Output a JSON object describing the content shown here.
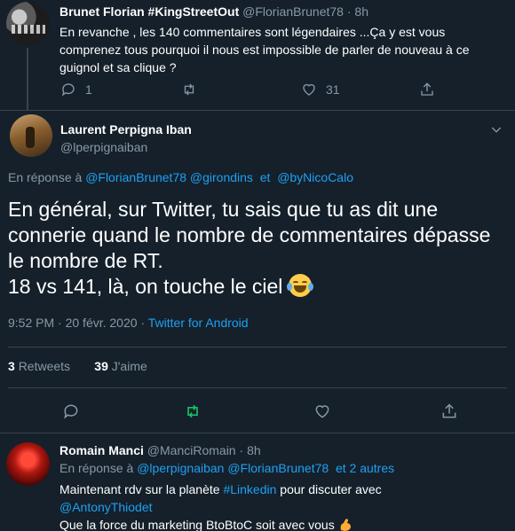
{
  "tweet_parent": {
    "name": "Brunet Florian #KingStreetOut",
    "handle": "@FlorianBrunet78",
    "time": "8h",
    "text": "En revanche , les 140 commentaires sont légendaires ...Ça y est vous comprenez tous pourquoi il nous est impossible de parler de nouveau à ce guignol et sa clique ?",
    "reply_count": "1",
    "like_count": "31"
  },
  "main_tweet": {
    "name": "Laurent Perpigna Iban",
    "handle": "@lperpignaiban",
    "replying_prefix": "En réponse à",
    "replying_to": [
      "@FlorianBrunet78",
      "@girondins",
      "@byNicoCalo"
    ],
    "replying_and": "et",
    "body_lines": [
      "En général, sur Twitter, tu sais que tu as dit une connerie quand le nombre de commentaires dépasse le nombre de RT.",
      "18 vs 141,  là, on touche le ciel"
    ],
    "time": "9:52 PM",
    "date": "20 févr. 2020",
    "separator": "·",
    "source": "Twitter for Android",
    "retweets_count": "3",
    "retweets_label": "Retweets",
    "likes_count": "39",
    "likes_label": "J'aime"
  },
  "reply_tweet": {
    "name": "Romain Manci",
    "handle": "@ManciRomain",
    "time": "8h",
    "replying_prefix": "En réponse à",
    "replying_to": [
      "@lperpignaiban",
      "@FlorianBrunet78"
    ],
    "replying_more": "et 2 autres",
    "line1_prefix": "Maintenant rdv sur la planète",
    "line1_hashtag": "#Linkedin",
    "line1_suffix": "pour discuter avec",
    "line2_mention": "@AntonyThiodet",
    "line3": "Que la force du marketing BtoBtoC soit avec vous"
  },
  "icons": {
    "reply": "reply-icon",
    "retweet": "retweet-icon",
    "like": "heart-icon",
    "share": "share-icon",
    "more": "chevron-down-icon",
    "emoji_laugh": "tears-of-joy-emoji",
    "emoji_flex": "flexed-biceps-emoji"
  },
  "colors": {
    "background": "#15202b",
    "link": "#1da1f2",
    "muted": "#8899a6",
    "retweet_active": "#17bf63",
    "divider": "#38444d"
  }
}
